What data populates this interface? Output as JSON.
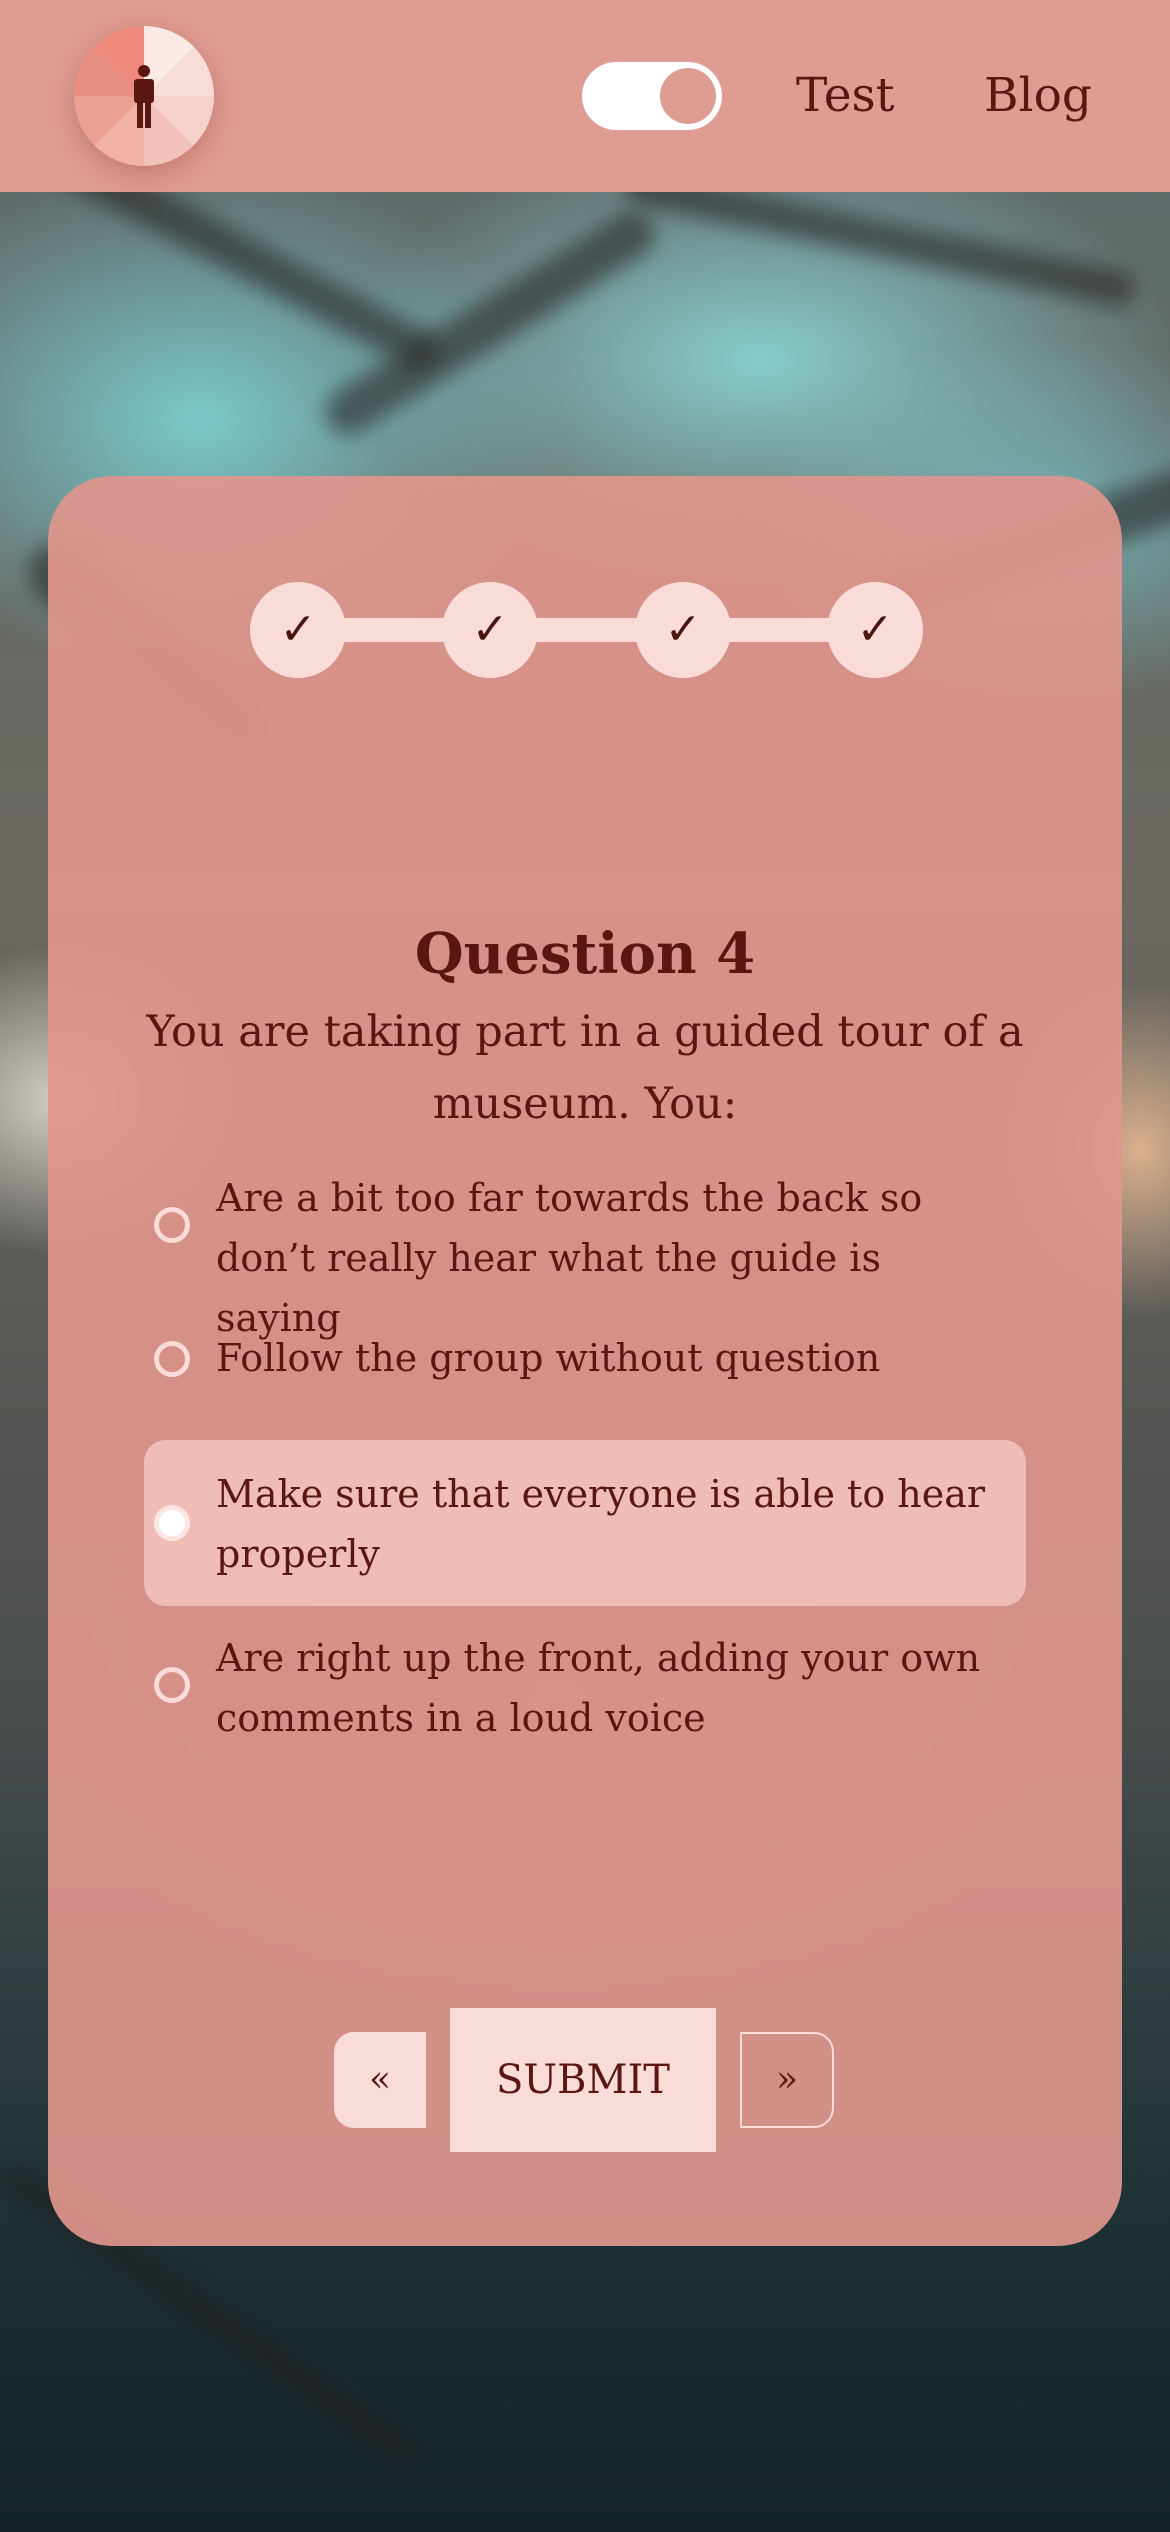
{
  "header": {
    "logo_icon": "person-pie-logo-icon",
    "theme_toggle": {
      "state": "on"
    },
    "nav": [
      {
        "label": "Test"
      },
      {
        "label": "Blog"
      }
    ]
  },
  "quiz": {
    "progress": {
      "steps": [
        {
          "mark": "✓",
          "completed": true
        },
        {
          "mark": "✓",
          "completed": true
        },
        {
          "mark": "✓",
          "completed": true
        },
        {
          "mark": "✓",
          "completed": true
        }
      ]
    },
    "question_title": "Question 4",
    "question_text": "You are taking part in a guided tour of a museum. You:",
    "answers": [
      {
        "text": "Are a bit too far towards the back so don’t really hear what the guide is saying",
        "selected": false
      },
      {
        "text": "Follow the group without question",
        "selected": false
      },
      {
        "text": "Make sure that everyone is able to hear properly",
        "selected": true
      },
      {
        "text": "Are right up the front, adding your own comments in a loud voice",
        "selected": false
      }
    ],
    "buttons": {
      "prev_label": "«",
      "submit_label": "SUBMIT",
      "next_label": "»"
    }
  },
  "colors": {
    "header_bg": "#df9c93",
    "card_bg": "#df968c",
    "accent_light": "#f9dcd8",
    "selected_bg": "#efbdb6",
    "text": "#5a1712"
  }
}
